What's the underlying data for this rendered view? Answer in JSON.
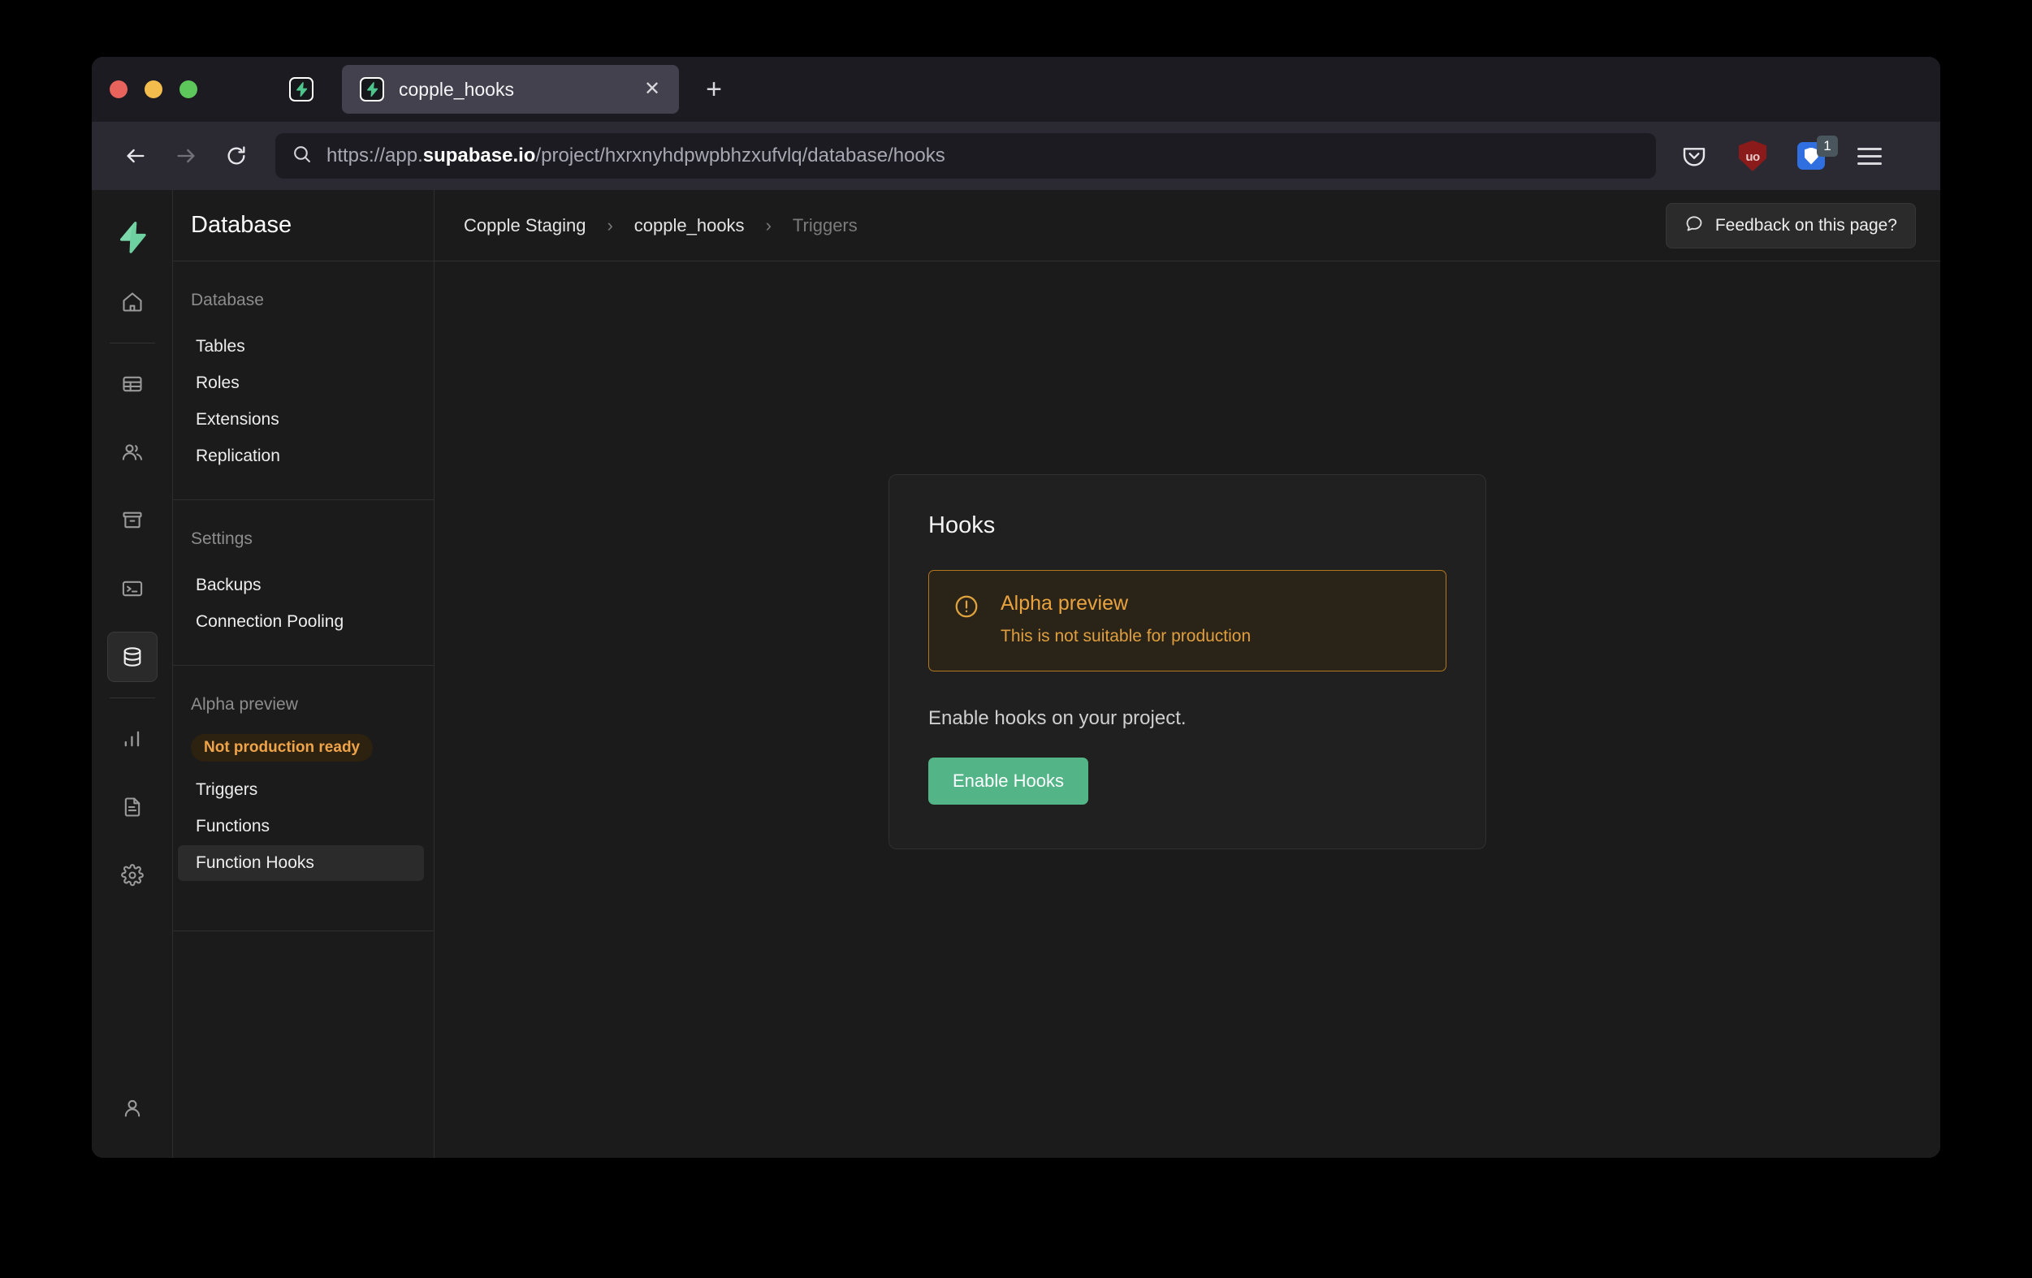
{
  "browser": {
    "pinned_tab_icon": "supabase-bolt-icon",
    "tab": {
      "favicon": "supabase-bolt-icon",
      "title": "copple_hooks",
      "close_label": "✕"
    },
    "new_tab_label": "+",
    "nav": {
      "back_icon": "arrow-left-icon",
      "forward_icon": "arrow-right-icon",
      "reload_icon": "reload-icon",
      "search_icon": "search-icon"
    },
    "url": {
      "prefix": "https://app.",
      "host_bold": "supabase.io",
      "suffix": "/project/hxrxnyhdpwpbhzxufvlq/database/hooks",
      "full": "https://app.supabase.io/project/hxrxnyhdpwpbhzxufvlq/database/hooks"
    },
    "toolbar": {
      "pocket_icon": "pocket-icon",
      "ublock_label": "uo",
      "extension_badge": "1",
      "menu_icon": "hamburger-menu-icon"
    },
    "window_controls": {
      "close_color": "#e8635c",
      "minimize_color": "#f3bd4e",
      "maximize_color": "#5ec75c"
    }
  },
  "rail": {
    "logo": "supabase-logo",
    "items": [
      {
        "name": "home",
        "icon": "home-icon"
      },
      {
        "name": "table-editor",
        "icon": "table-icon"
      },
      {
        "name": "authentication",
        "icon": "users-icon"
      },
      {
        "name": "storage",
        "icon": "archive-icon"
      },
      {
        "name": "sql-editor",
        "icon": "terminal-icon"
      },
      {
        "name": "database",
        "icon": "database-icon",
        "active": true
      },
      {
        "name": "reports",
        "icon": "bar-chart-icon"
      },
      {
        "name": "logs",
        "icon": "document-icon"
      },
      {
        "name": "settings",
        "icon": "gear-icon"
      },
      {
        "name": "account",
        "icon": "user-icon"
      }
    ]
  },
  "secondary_nav": {
    "title": "Database",
    "groups": [
      {
        "label": "Database",
        "links": [
          {
            "label": "Tables",
            "active": false
          },
          {
            "label": "Roles",
            "active": false
          },
          {
            "label": "Extensions",
            "active": false
          },
          {
            "label": "Replication",
            "active": false
          }
        ]
      },
      {
        "label": "Settings",
        "links": [
          {
            "label": "Backups",
            "active": false
          },
          {
            "label": "Connection Pooling",
            "active": false
          }
        ]
      },
      {
        "label": "Alpha preview",
        "badge": "Not production ready",
        "links": [
          {
            "label": "Triggers",
            "active": false
          },
          {
            "label": "Functions",
            "active": false
          },
          {
            "label": "Function Hooks",
            "active": true
          }
        ]
      }
    ]
  },
  "header": {
    "breadcrumb": [
      {
        "label": "Copple Staging",
        "muted": false
      },
      {
        "label": "copple_hooks",
        "muted": false
      },
      {
        "label": "Triggers",
        "muted": true
      }
    ],
    "separator": "›",
    "feedback": {
      "icon": "chat-bubble-icon",
      "label": "Feedback on this page?"
    }
  },
  "card": {
    "title": "Hooks",
    "alert": {
      "icon": "alert-circle-icon",
      "title": "Alpha preview",
      "description": "This is not suitable for production",
      "border_color": "#b2771f",
      "background_color": "#2a2318",
      "text_color": "#e09f3e"
    },
    "description": "Enable hooks on your project.",
    "primary_button": {
      "label": "Enable Hooks",
      "color": "#53b587"
    }
  },
  "theme": {
    "page_background": "#000000",
    "app_background": "#1b1b1b",
    "card_background": "#202020",
    "border": "#2e2e2e",
    "accent_green": "#3ecf8e",
    "accent_amber": "#f0a44a"
  }
}
